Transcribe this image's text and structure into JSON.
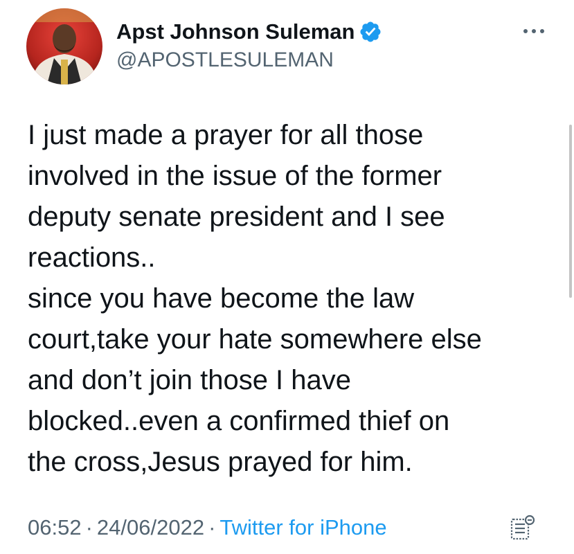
{
  "user": {
    "display_name": "Apst Johnson Suleman",
    "handle": "@APOSTLESULEMAN",
    "verified": true
  },
  "tweet": {
    "lines": [
      "I just made a prayer for all those",
      "involved in the issue of the former",
      "deputy senate president and I see",
      "reactions..",
      "since you have become the law",
      "court,take your hate somewhere else",
      "and don’t join those I have",
      "blocked..even a confirmed thief on",
      "the cross,Jesus prayed for him."
    ],
    "time": "06:52",
    "separator": "·",
    "date": "24/06/2022",
    "source": "Twitter for iPhone"
  },
  "icons": {
    "verified": "verified-badge-icon",
    "more": "more-options-icon",
    "analytics": "analytics-icon"
  },
  "colors": {
    "accent": "#1d9bf0",
    "secondary_text": "#536471",
    "primary_text": "#0f1419"
  }
}
